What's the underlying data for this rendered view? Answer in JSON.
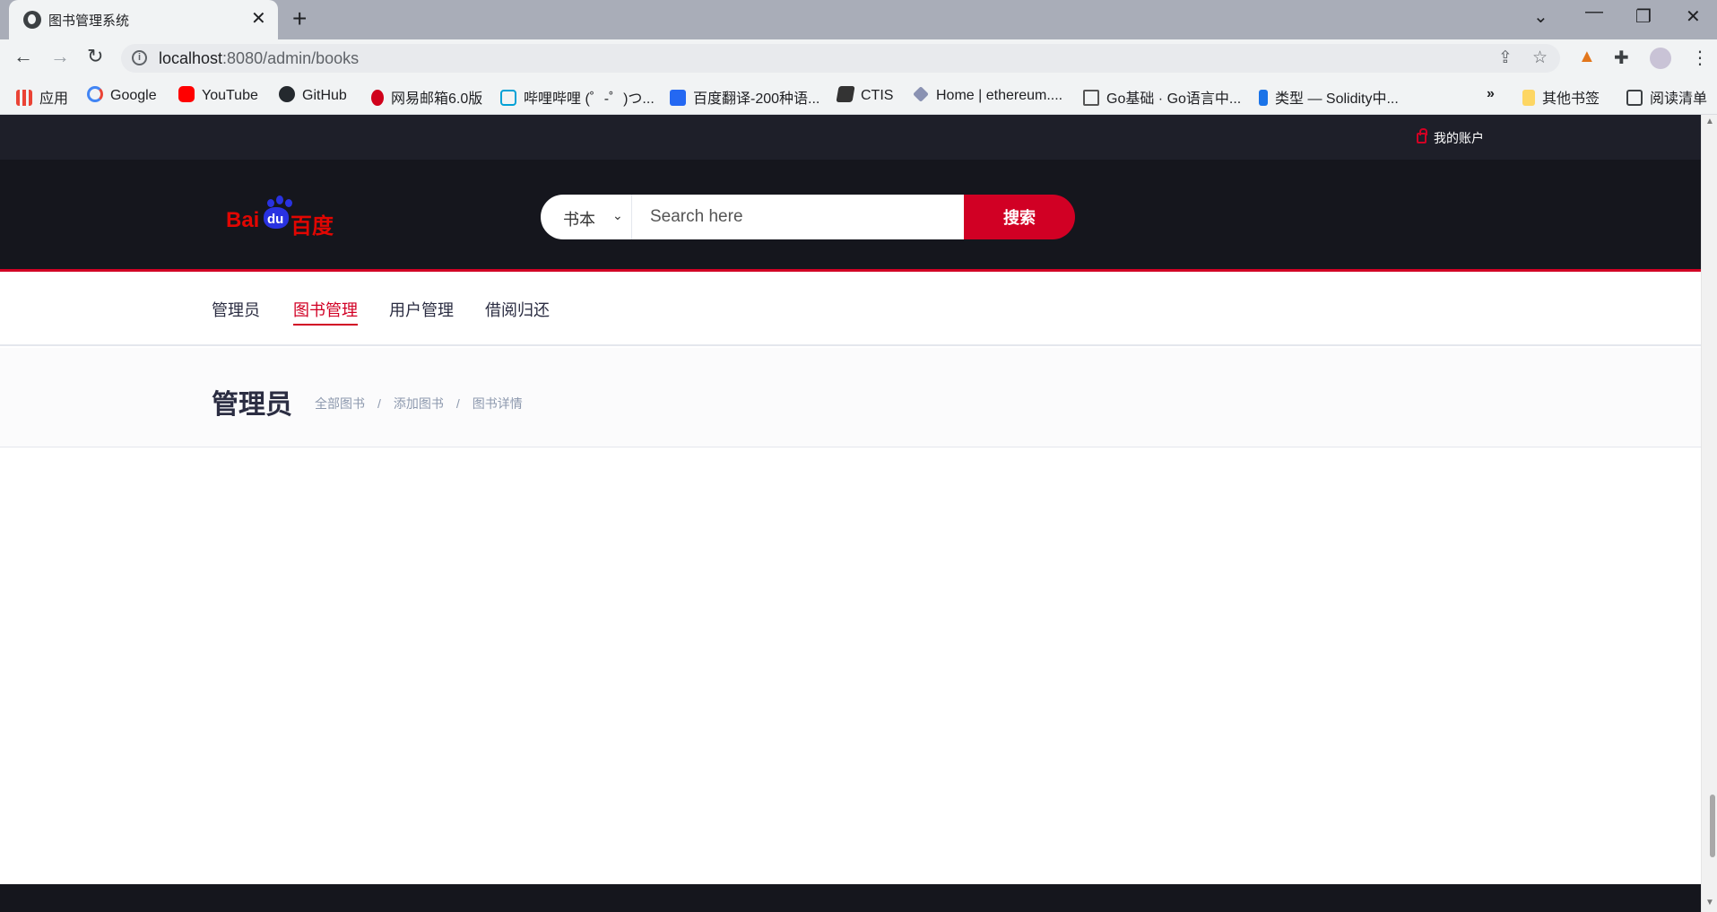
{
  "browser": {
    "tab_title": "图书管理系统",
    "url_host": "localhost",
    "url_path": ":8080/admin/books",
    "bookmarks": [
      {
        "label": "应用",
        "color": "#4285f4"
      },
      {
        "label": "Google",
        "color": "#ea4335"
      },
      {
        "label": "YouTube",
        "color": "#ff0000"
      },
      {
        "label": "GitHub",
        "color": "#24292e"
      },
      {
        "label": "网易邮箱6.0版",
        "color": "#d0021b"
      },
      {
        "label": "哔哩哔哩 (゜-゜)つ...",
        "color": "#00a1d6"
      },
      {
        "label": "百度翻译-200种语...",
        "color": "#2468f2"
      },
      {
        "label": "CTIS",
        "color": "#333333"
      },
      {
        "label": "Home | ethereum....",
        "color": "#8a92b2"
      },
      {
        "label": "Go基础 · Go语言中...",
        "color": "#555555"
      },
      {
        "label": "类型 — Solidity中...",
        "color": "#1a73e8"
      }
    ],
    "overflow_label": "»",
    "other_bookmarks": "其他书签",
    "reading_list": "阅读清单"
  },
  "topbar": {
    "account_label": "我的账户"
  },
  "header": {
    "logo_text_left": "Bai",
    "logo_text_mid": "du",
    "logo_text_right": "百度",
    "category_selected": "书本",
    "search_placeholder": "Search here",
    "search_button": "搜索"
  },
  "nav": {
    "items": [
      {
        "label": "管理员",
        "active": false
      },
      {
        "label": "图书管理",
        "active": true
      },
      {
        "label": "用户管理",
        "active": false
      },
      {
        "label": "借阅归还",
        "active": false
      }
    ]
  },
  "breadcrumb": {
    "title": "管理员",
    "links": [
      "全部图书",
      "添加图书",
      "图书详情"
    ],
    "separator": "/"
  },
  "colors": {
    "accent": "#d10024",
    "header_bg": "#15161d",
    "topbar_bg": "#1e1f29"
  }
}
